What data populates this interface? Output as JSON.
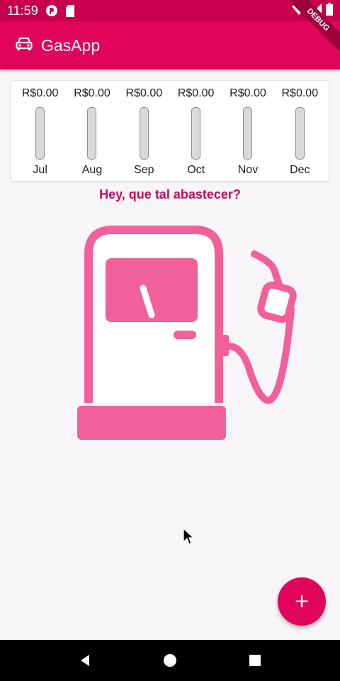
{
  "status_bar": {
    "time": "11:59",
    "icons": [
      "notification-icon",
      "sd-card-icon",
      "wifi-icon",
      "signal-icon",
      "battery-icon"
    ]
  },
  "app_bar": {
    "title": "GasApp",
    "icon": "car-icon",
    "debug_banner": "DEBUG"
  },
  "chart": {
    "months": [
      {
        "value": "R$0.00",
        "label": "Jul",
        "fill": 0
      },
      {
        "value": "R$0.00",
        "label": "Aug",
        "fill": 0
      },
      {
        "value": "R$0.00",
        "label": "Sep",
        "fill": 0
      },
      {
        "value": "R$0.00",
        "label": "Oct",
        "fill": 0
      },
      {
        "value": "R$0.00",
        "label": "Nov",
        "fill": 0
      },
      {
        "value": "R$0.00",
        "label": "Dec",
        "fill": 0
      }
    ]
  },
  "empty_state": {
    "message": "Hey, que tal abastecer?",
    "illustration": "gas-pump-illustration"
  },
  "fab": {
    "label": "+",
    "icon": "add-icon"
  },
  "colors": {
    "primary": "#e0045a",
    "status_bar": "#c8004c",
    "illustration": "#f2609a",
    "prompt_text": "#c8085a"
  }
}
